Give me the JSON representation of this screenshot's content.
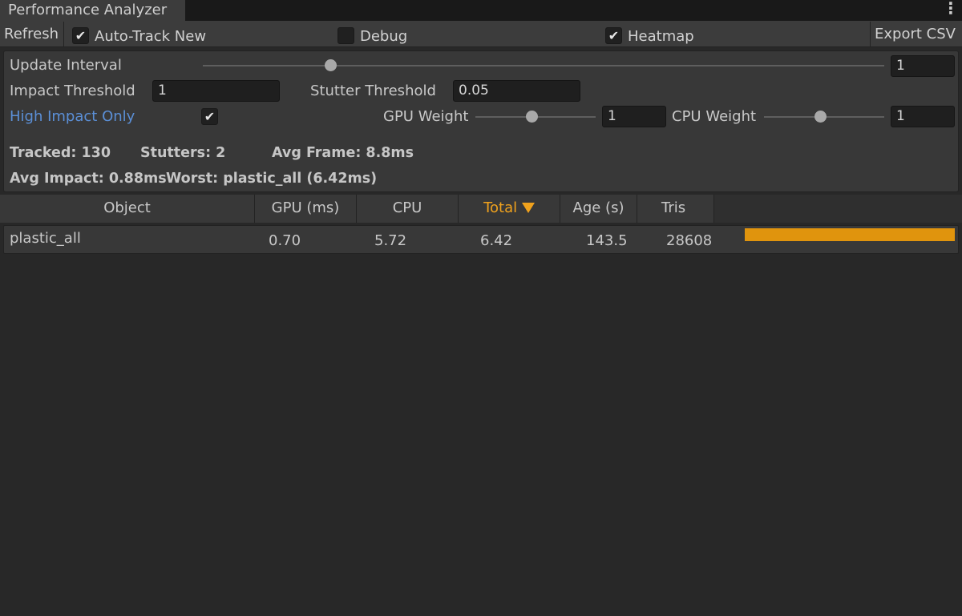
{
  "window": {
    "tab_title": "Performance Analyzer",
    "menu_icon": "kebab-menu-icon"
  },
  "toolbar": {
    "refresh_label": "Refresh",
    "auto_track": {
      "label": "Auto-Track New",
      "checked": true
    },
    "debug": {
      "label": "Debug",
      "checked": false
    },
    "heatmap": {
      "label": "Heatmap",
      "checked": true
    },
    "export_label": "Export CSV"
  },
  "settings": {
    "update_interval": {
      "label": "Update Interval",
      "value": "1",
      "slider_fraction": 0.1
    },
    "impact_threshold": {
      "label": "Impact Threshold",
      "value": "1"
    },
    "stutter_threshold": {
      "label": "Stutter Threshold",
      "value": "0.05"
    },
    "high_impact_only": {
      "label": "High Impact Only",
      "checked": true
    },
    "gpu_weight": {
      "label": "GPU Weight",
      "value": "1",
      "slider_fraction": 0.5
    },
    "cpu_weight": {
      "label": "CPU Weight",
      "value": "1",
      "slider_fraction": 0.5
    }
  },
  "stats": {
    "tracked": "Tracked: 130",
    "stutters": "Stutters: 2",
    "avg_frame": "Avg Frame: 8.8ms",
    "avg_impact": "Avg Impact: 0.88ms",
    "worst": "Worst: plastic_all (6.42ms)"
  },
  "table": {
    "columns": [
      "Object",
      "GPU (ms)",
      "CPU",
      "Total",
      "Age (s)",
      "Tris"
    ],
    "sort_column": "Total",
    "sort_icon": "sort-descending-icon",
    "rows": [
      {
        "object": "plastic_all",
        "gpu": "0.70",
        "cpu": "5.72",
        "total": "6.42",
        "age": "143.5",
        "tris": "28608",
        "impact_fraction": 1.0
      }
    ]
  },
  "colors": {
    "accent_orange": "#f0a21d",
    "bar_orange": "#e0940d",
    "link_blue": "#5b8fd6",
    "background": "#282828",
    "panel": "#383838"
  }
}
